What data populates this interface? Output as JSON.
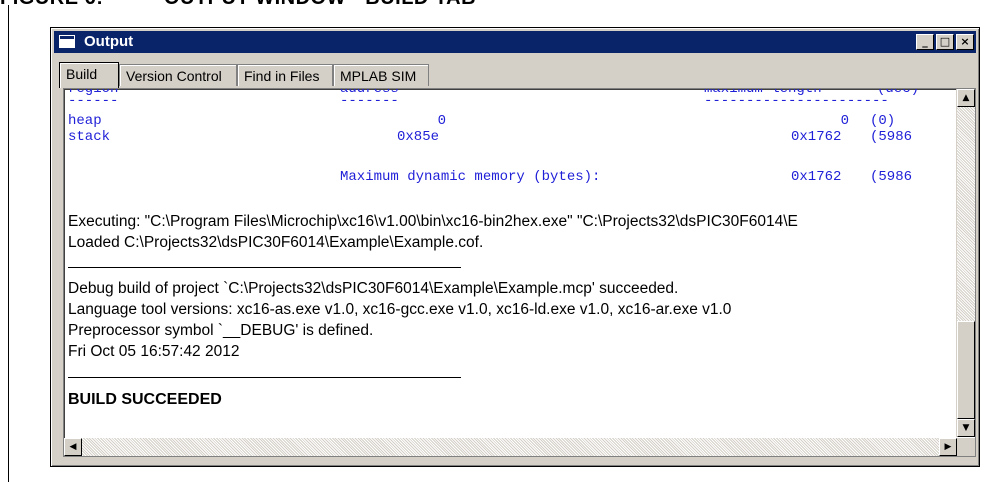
{
  "figure": {
    "caption": "FIGURE 6:          OUTPUT WINDOW - BUILD TAB"
  },
  "window": {
    "title": "Output",
    "controls": {
      "minimize": "_",
      "maximize": "□",
      "close": "×"
    }
  },
  "tabs": [
    {
      "label": "Build",
      "active": true
    },
    {
      "label": "Version Control",
      "active": false
    },
    {
      "label": "Find in Files",
      "active": false
    },
    {
      "label": "MPLAB SIM",
      "active": false
    }
  ],
  "output": {
    "memory_header": {
      "region": "region",
      "address": "address",
      "maxlen": "maximum length",
      "dec": "(dec)",
      "dash1": "------",
      "dash2": "-------",
      "dash3": "----------------------"
    },
    "memory_rows": [
      {
        "region": "heap",
        "address": "0",
        "maxlen": "0",
        "dec": "(0)"
      },
      {
        "region": "stack",
        "address": "0x85e",
        "maxlen": "0x1762",
        "dec": "(5986"
      }
    ],
    "max_dynamic": {
      "label": "Maximum dynamic memory (bytes):",
      "value": "0x1762",
      "dec": "(5986"
    },
    "lines": [
      "Executing: \"C:\\Program Files\\Microchip\\xc16\\v1.00\\bin\\xc16-bin2hex.exe\" \"C:\\Projects32\\dsPIC30F6014\\E",
      "Loaded C:\\Projects32\\dsPIC30F6014\\Example\\Example.cof.",
      "Debug build of project `C:\\Projects32\\dsPIC30F6014\\Example\\Example.mcp' succeeded.",
      "Language tool versions: xc16-as.exe v1.0, xc16-gcc.exe v1.0, xc16-ld.exe v1.0, xc16-ar.exe v1.0",
      "Preprocessor symbol `__DEBUG' is defined.",
      "Fri Oct 05 16:57:42 2012"
    ],
    "result": "BUILD SUCCEEDED"
  },
  "scrollbar": {
    "up": "▲",
    "down": "▼",
    "left": "◀",
    "right": "▶"
  },
  "colors": {
    "titlebar": "#0a246a",
    "console_text": "#1f1fd8",
    "chrome": "#d4d0c8"
  }
}
